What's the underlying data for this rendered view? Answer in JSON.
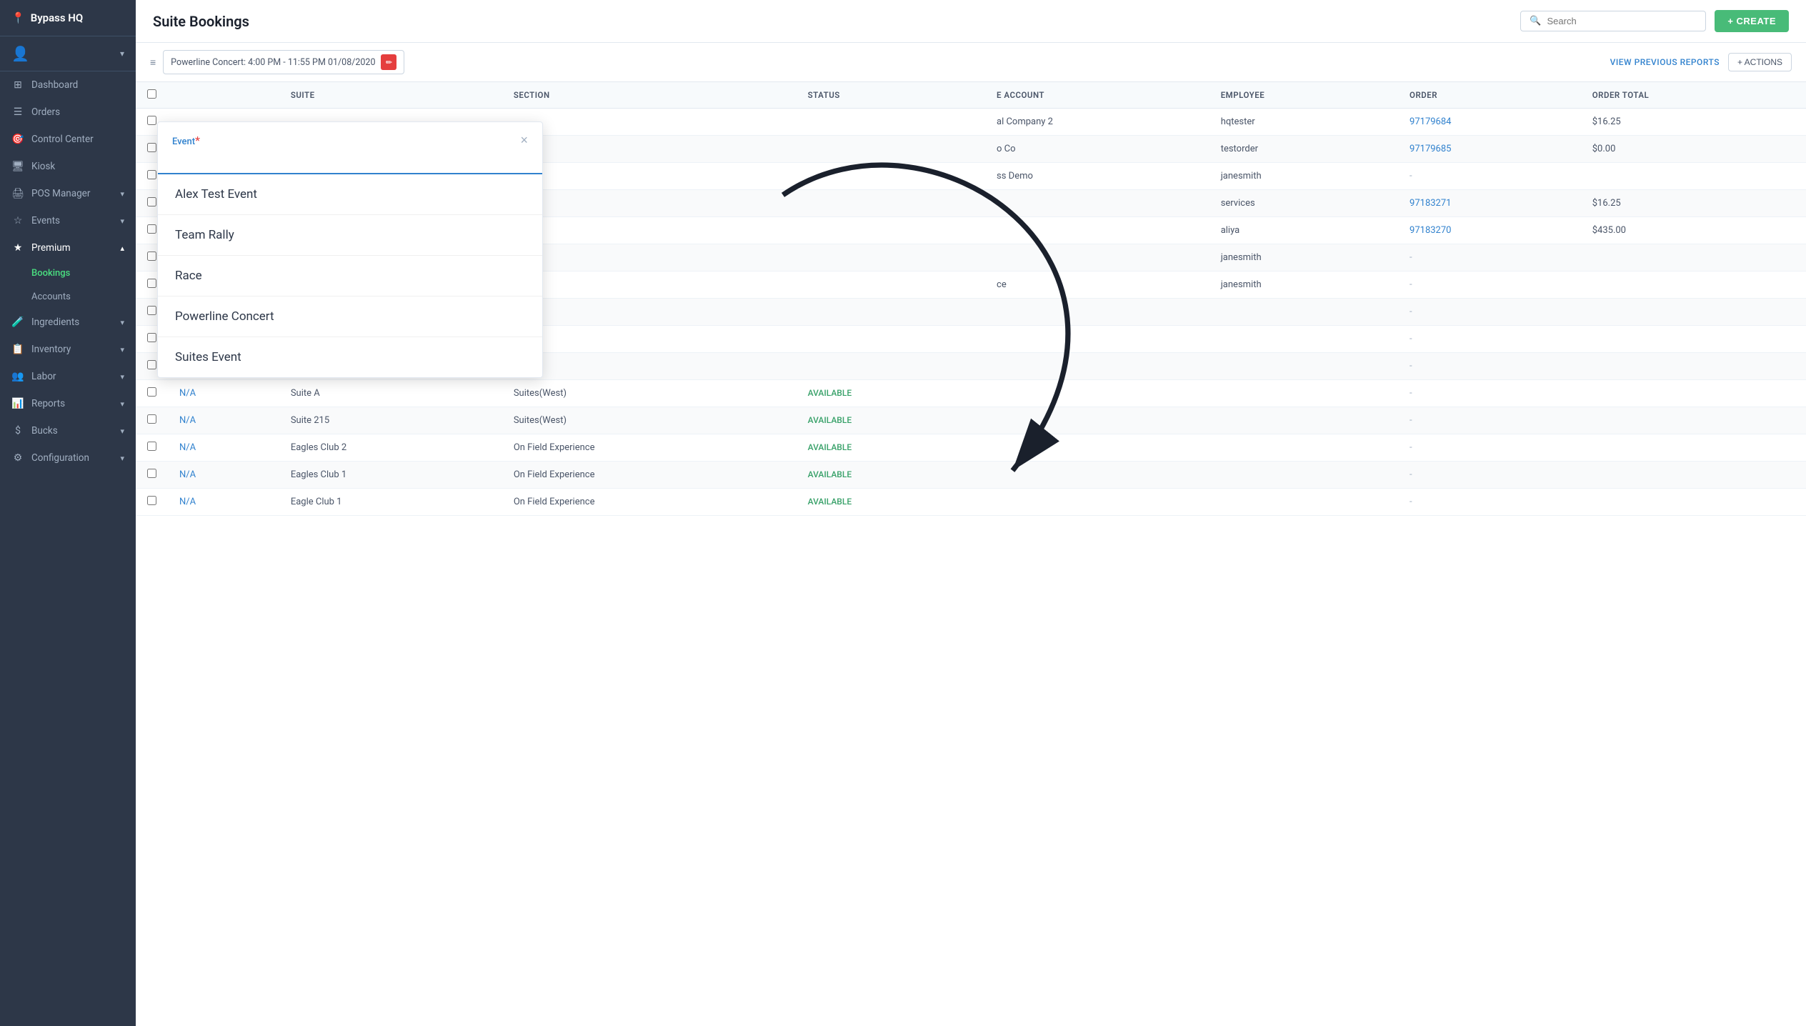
{
  "sidebar": {
    "logo": "Bypass HQ",
    "logo_icon": "📍",
    "nav_items": [
      {
        "id": "dashboard",
        "label": "Dashboard",
        "icon": "⊞",
        "has_chevron": false
      },
      {
        "id": "orders",
        "label": "Orders",
        "icon": "☰",
        "has_chevron": false
      },
      {
        "id": "control-center",
        "label": "Control Center",
        "icon": "👤",
        "has_chevron": false
      },
      {
        "id": "kiosk",
        "label": "Kiosk",
        "icon": "🖥",
        "has_chevron": false
      },
      {
        "id": "pos-manager",
        "label": "POS Manager",
        "icon": "🖨",
        "has_chevron": true
      },
      {
        "id": "events",
        "label": "Events",
        "icon": "⭐",
        "has_chevron": true
      },
      {
        "id": "premium",
        "label": "Premium",
        "icon": "★",
        "has_chevron": true,
        "active": true
      },
      {
        "id": "ingredients",
        "label": "Ingredients",
        "icon": "🧪",
        "has_chevron": true
      },
      {
        "id": "inventory",
        "label": "Inventory",
        "icon": "📋",
        "has_chevron": true
      },
      {
        "id": "labor",
        "label": "Labor",
        "icon": "👥",
        "has_chevron": true
      },
      {
        "id": "reports",
        "label": "Reports",
        "icon": "📊",
        "has_chevron": true
      },
      {
        "id": "bucks",
        "label": "Bucks",
        "icon": "$",
        "has_chevron": true
      },
      {
        "id": "configuration",
        "label": "Configuration",
        "icon": "⚙",
        "has_chevron": true
      }
    ],
    "sub_items": [
      {
        "id": "bookings",
        "label": "Bookings",
        "active": true
      },
      {
        "id": "accounts",
        "label": "Accounts",
        "active": false
      }
    ]
  },
  "topbar": {
    "title": "Suite Bookings",
    "search_placeholder": "Search",
    "create_label": "+ CREATE"
  },
  "filter_bar": {
    "tag_label": "Powerline Concert: 4:00 PM - 11:55 PM 01/08/2020",
    "view_previous_reports": "VIEW PREVIOUS REPORTS",
    "actions_label": "+ ACTIONS"
  },
  "table": {
    "columns": [
      "",
      "",
      "SUITE",
      "SECTION",
      "STATUS",
      "E ACCOUNT",
      "EMPLOYEE",
      "ORDER",
      "ORDER TOTAL"
    ],
    "rows": [
      {
        "id": "1",
        "suite": "",
        "section": "",
        "status": "",
        "account": "al Company 2",
        "employee": "hqtester",
        "order": "97179684",
        "order_total": "$16.25"
      },
      {
        "id": "2",
        "suite": "",
        "section": "",
        "status": "",
        "account": "o Co",
        "employee": "testorder",
        "order": "97179685",
        "order_total": "$0.00"
      },
      {
        "id": "3",
        "suite": "",
        "section": "",
        "status": "",
        "account": "ss Demo",
        "employee": "janesmith",
        "order": "-",
        "order_total": ""
      },
      {
        "id": "4",
        "suite": "",
        "section": "",
        "status": "",
        "account": "",
        "employee": "services",
        "order": "97183271",
        "order_total": "$16.25"
      },
      {
        "id": "5",
        "suite": "",
        "section": "",
        "status": "",
        "account": "",
        "employee": "aliya",
        "order": "97183270",
        "order_total": "$435.00"
      },
      {
        "id": "6",
        "suite": "",
        "section": "",
        "status": "",
        "account": "",
        "employee": "janesmith",
        "order": "-",
        "order_total": ""
      },
      {
        "id": "7",
        "suite": "",
        "section": "",
        "status": "",
        "account": "ce",
        "employee": "janesmith",
        "order": "-",
        "order_total": ""
      },
      {
        "id": "8",
        "suite": "",
        "section": "",
        "status": "",
        "account": "",
        "employee": "",
        "order": "-",
        "order_total": ""
      },
      {
        "id": "9",
        "suite": "",
        "section": "",
        "status": "",
        "account": "",
        "employee": "",
        "order": "-",
        "order_total": ""
      },
      {
        "id": "10",
        "suite": "",
        "section": "",
        "status": "",
        "account": "",
        "employee": "",
        "order": "-",
        "order_total": ""
      },
      {
        "id": "na1",
        "suite": "Suite A",
        "section": "Suites(West)",
        "status": "AVAILABLE",
        "account": "",
        "employee": "",
        "order": "-",
        "order_total": ""
      },
      {
        "id": "na2",
        "suite": "Suite 215",
        "section": "Suites(West)",
        "status": "AVAILABLE",
        "account": "",
        "employee": "",
        "order": "-",
        "order_total": ""
      },
      {
        "id": "na3",
        "suite": "Eagles Club 2",
        "section": "On Field Experience",
        "status": "AVAILABLE",
        "account": "",
        "employee": "",
        "order": "-",
        "order_total": ""
      },
      {
        "id": "na4",
        "suite": "Eagles Club 1",
        "section": "On Field Experience",
        "status": "AVAILABLE",
        "account": "",
        "employee": "",
        "order": "-",
        "order_total": ""
      },
      {
        "id": "na5",
        "suite": "Eagle Club 1",
        "section": "On Field Experience",
        "status": "AVAILABLE",
        "account": "",
        "employee": "",
        "order": "-",
        "order_total": ""
      }
    ]
  },
  "event_modal": {
    "label": "Event",
    "required_marker": "*",
    "close_label": "×",
    "options": [
      "Alex Test Event",
      "Team Rally",
      "Race",
      "Powerline Concert",
      "Suites Event"
    ]
  }
}
